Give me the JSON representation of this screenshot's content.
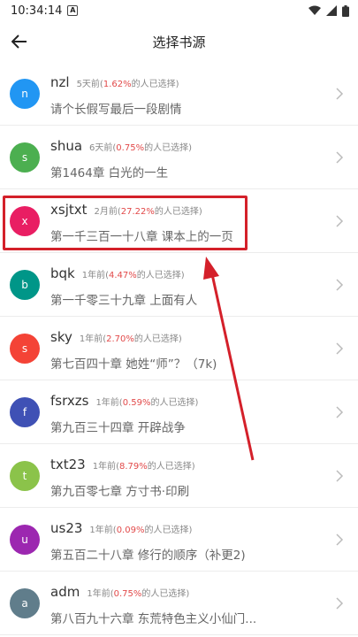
{
  "status_bar": {
    "time": "10:34:14",
    "a_icon": "A"
  },
  "header": {
    "title": "选择书源",
    "back_icon": "arrow-left-icon"
  },
  "sources": [
    {
      "avatar": "n",
      "color": "#2196f3",
      "name": "nzl",
      "time": "5天前(",
      "percent": "1.62%",
      "suffix": "的人已选择)",
      "chapter": "请个长假写最后一段剧情"
    },
    {
      "avatar": "s",
      "color": "#4caf50",
      "name": "shua",
      "time": "6天前(",
      "percent": "0.75%",
      "suffix": "的人已选择)",
      "chapter": "第1464章 白光的一生"
    },
    {
      "avatar": "x",
      "color": "#e91e63",
      "name": "xsjtxt",
      "time": "2月前(",
      "percent": "27.22%",
      "suffix": "的人已选择)",
      "chapter": "第一千三百一十八章 课本上的一页"
    },
    {
      "avatar": "b",
      "color": "#009688",
      "name": "bqk",
      "time": "1年前(",
      "percent": "4.47%",
      "suffix": "的人已选择)",
      "chapter": "第一千零三十九章 上面有人"
    },
    {
      "avatar": "s",
      "color": "#f44336",
      "name": "sky",
      "time": "1年前(",
      "percent": "2.70%",
      "suffix": "的人已选择)",
      "chapter": "第七百四十章 她姓“师”？（7k)"
    },
    {
      "avatar": "f",
      "color": "#3f51b5",
      "name": "fsrxzs",
      "time": "1年前(",
      "percent": "0.59%",
      "suffix": "的人已选择)",
      "chapter": "第九百三十四章 开辟战争"
    },
    {
      "avatar": "t",
      "color": "#8bc34a",
      "name": "txt23",
      "time": "1年前(",
      "percent": "8.79%",
      "suffix": "的人已选择)",
      "chapter": "第九百零七章 方寸书·印刷"
    },
    {
      "avatar": "u",
      "color": "#9c27b0",
      "name": "us23",
      "time": "1年前(",
      "percent": "0.09%",
      "suffix": "的人已选择)",
      "chapter": "第五百二十八章 修行的顺序（补更2)"
    },
    {
      "avatar": "a",
      "color": "#607d8b",
      "name": "adm",
      "time": "1年前(",
      "percent": "0.75%",
      "suffix": "的人已选择)",
      "chapter": "第八百九十六章 东荒特色主义小仙门..."
    }
  ],
  "annotation": {
    "highlight_color": "#d4202a"
  }
}
